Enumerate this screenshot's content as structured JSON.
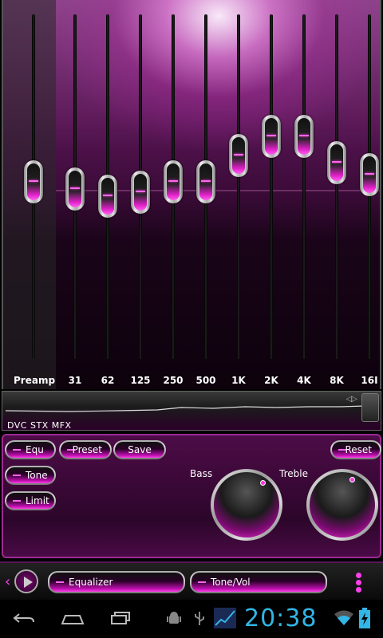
{
  "equalizer": {
    "bands": [
      {
        "label": "Preamp",
        "level": 0.0
      },
      {
        "label": "31",
        "level": -0.4
      },
      {
        "label": "62",
        "level": -0.8
      },
      {
        "label": "125",
        "level": -0.6
      },
      {
        "label": "250",
        "level": 0.0
      },
      {
        "label": "500",
        "level": 0.0
      },
      {
        "label": "1K",
        "level": 1.5
      },
      {
        "label": "2K",
        "level": 2.6
      },
      {
        "label": "4K",
        "level": 2.6
      },
      {
        "label": "8K",
        "level": 1.1
      },
      {
        "label": "16I",
        "level": 0.4
      }
    ],
    "accent_color": "#ff40ea"
  },
  "visualizer": {
    "label": "DVC STX MFX"
  },
  "panel": {
    "equ_label": "Equ",
    "tone_label": "Tone",
    "limit_label": "Limit",
    "preset_label": "Preset",
    "save_label": "Save",
    "reset_label": "Reset",
    "bass_label": "Bass",
    "treble_label": "Treble"
  },
  "tabbar": {
    "tab1_label": "Equalizer",
    "tab2_label": "Tone/Vol"
  },
  "system": {
    "time": "20:38",
    "clock_color": "#33b5e5",
    "nav_icons": [
      "back-icon",
      "home-icon",
      "recent-apps-icon"
    ],
    "status_icons": [
      "android-debug-icon",
      "usb-icon",
      "stock-graph-icon",
      "wifi-icon",
      "battery-charging-icon"
    ]
  }
}
